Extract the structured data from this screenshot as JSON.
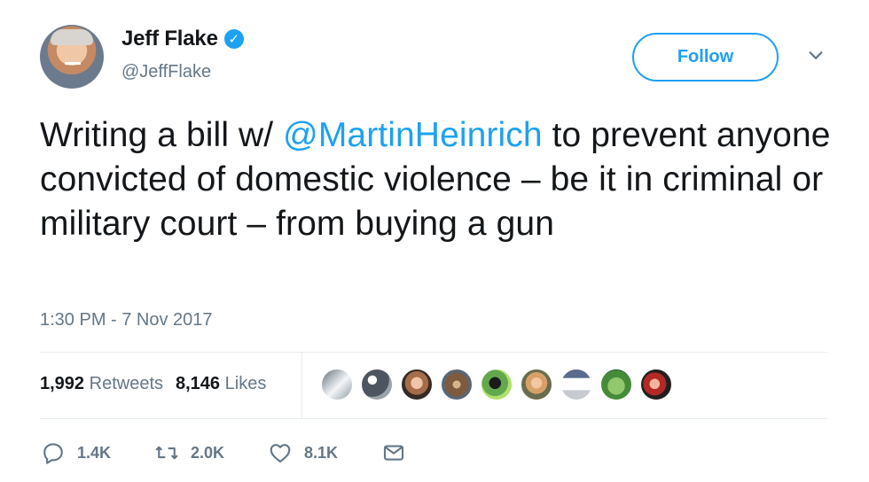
{
  "header": {
    "display_name": "Jeff Flake",
    "handle": "@JeffFlake",
    "follow_label": "Follow",
    "verified_icon": "verified-badge-icon",
    "menu_icon": "chevron-down-icon"
  },
  "tweet": {
    "text_before": "Writing a bill w/ ",
    "mention": "@MartinHeinrich",
    "text_after": " to prevent anyone convicted of domestic violence – be it in criminal or military court – from buying a gun",
    "timestamp": "1:30 PM - 7 Nov 2017"
  },
  "stats": {
    "retweets_count": "1,992",
    "retweets_label": "Retweets",
    "likes_count": "8,146",
    "likes_label": "Likes"
  },
  "actions": {
    "reply_count": "1.4K",
    "retweet_count": "2.0K",
    "like_count": "8.1K",
    "reply_icon": "reply-icon",
    "retweet_icon": "retweet-icon",
    "like_icon": "heart-icon",
    "dm_icon": "direct-message-icon"
  },
  "colors": {
    "accent": "#1da1f2",
    "text": "#14171a",
    "muted": "#657786",
    "border": "#e6ecf0"
  }
}
